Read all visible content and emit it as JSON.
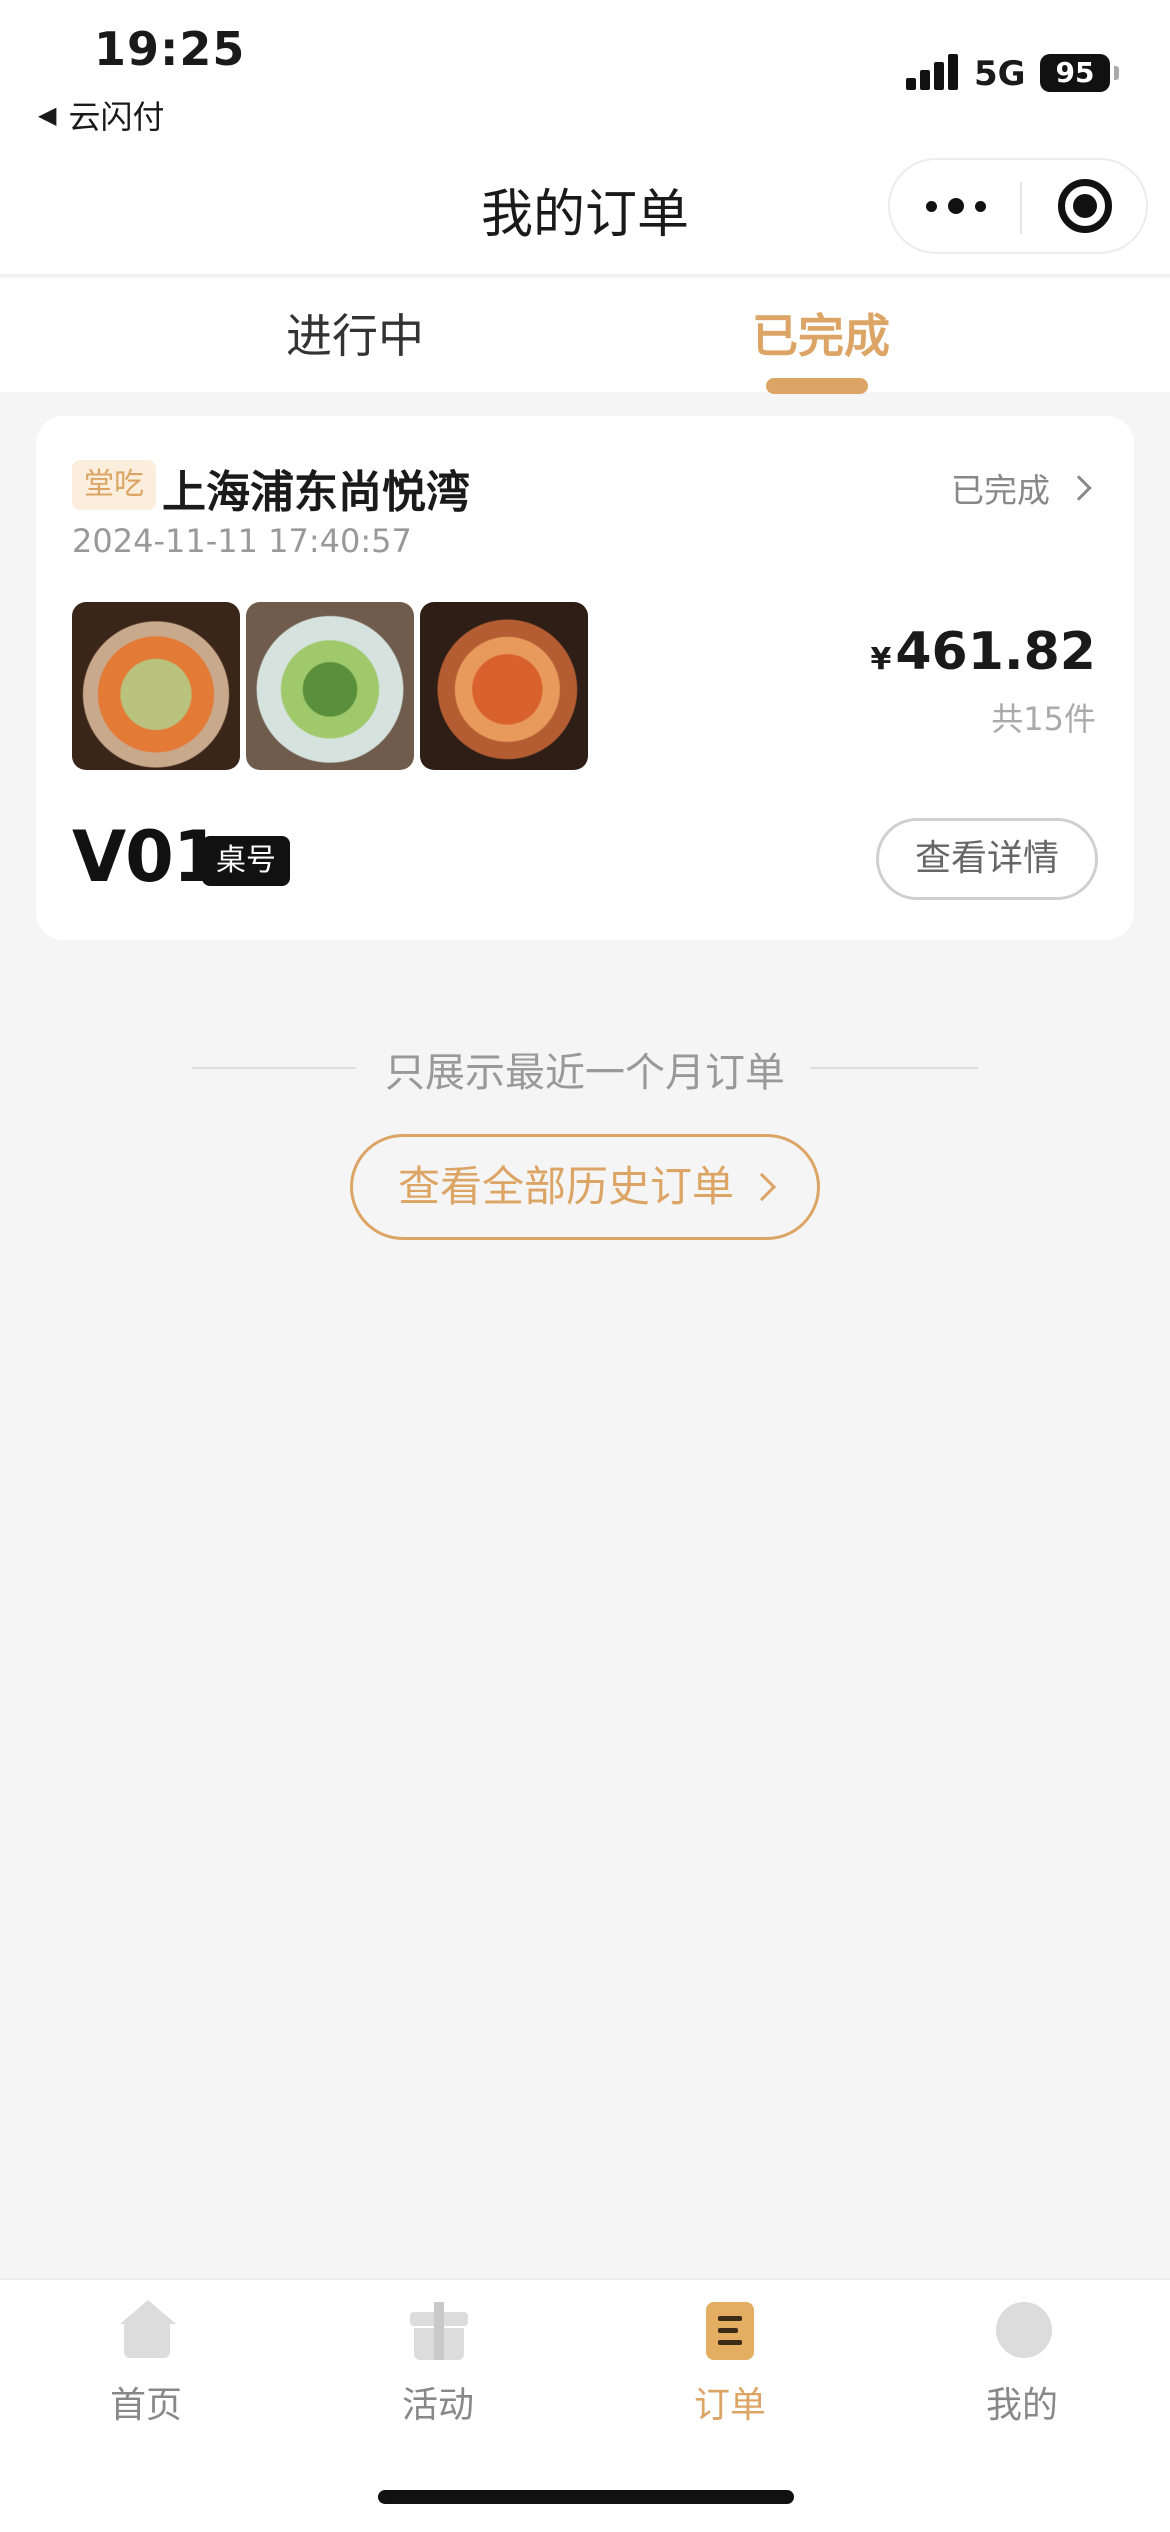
{
  "status_bar": {
    "time": "19:25",
    "back_app": "云闪付",
    "network": "5G",
    "battery": "95"
  },
  "nav": {
    "title": "我的订单"
  },
  "tabs": [
    {
      "label": "进行中",
      "active": false
    },
    {
      "label": "已完成",
      "active": true
    }
  ],
  "order": {
    "dine_type": "堂吃",
    "store_name": "上海浦东尚悦湾",
    "status": "已完成",
    "time": "2024-11-11 17:40:57",
    "currency": "¥",
    "amount": "461.82",
    "item_count": "共15件",
    "table_no": "V01",
    "table_label": "桌号",
    "detail_button": "查看详情"
  },
  "footer": {
    "recent_note": "只展示最近一个月订单",
    "history_button": "查看全部历史订单"
  },
  "tab_bar": [
    {
      "label": "首页",
      "icon": "home-icon",
      "active": false
    },
    {
      "label": "活动",
      "icon": "gift-icon",
      "active": false
    },
    {
      "label": "订单",
      "icon": "order-icon",
      "active": true
    },
    {
      "label": "我的",
      "icon": "profile-icon",
      "active": false
    }
  ],
  "colors": {
    "accent": "#dca565",
    "background": "#f5f5f5"
  }
}
